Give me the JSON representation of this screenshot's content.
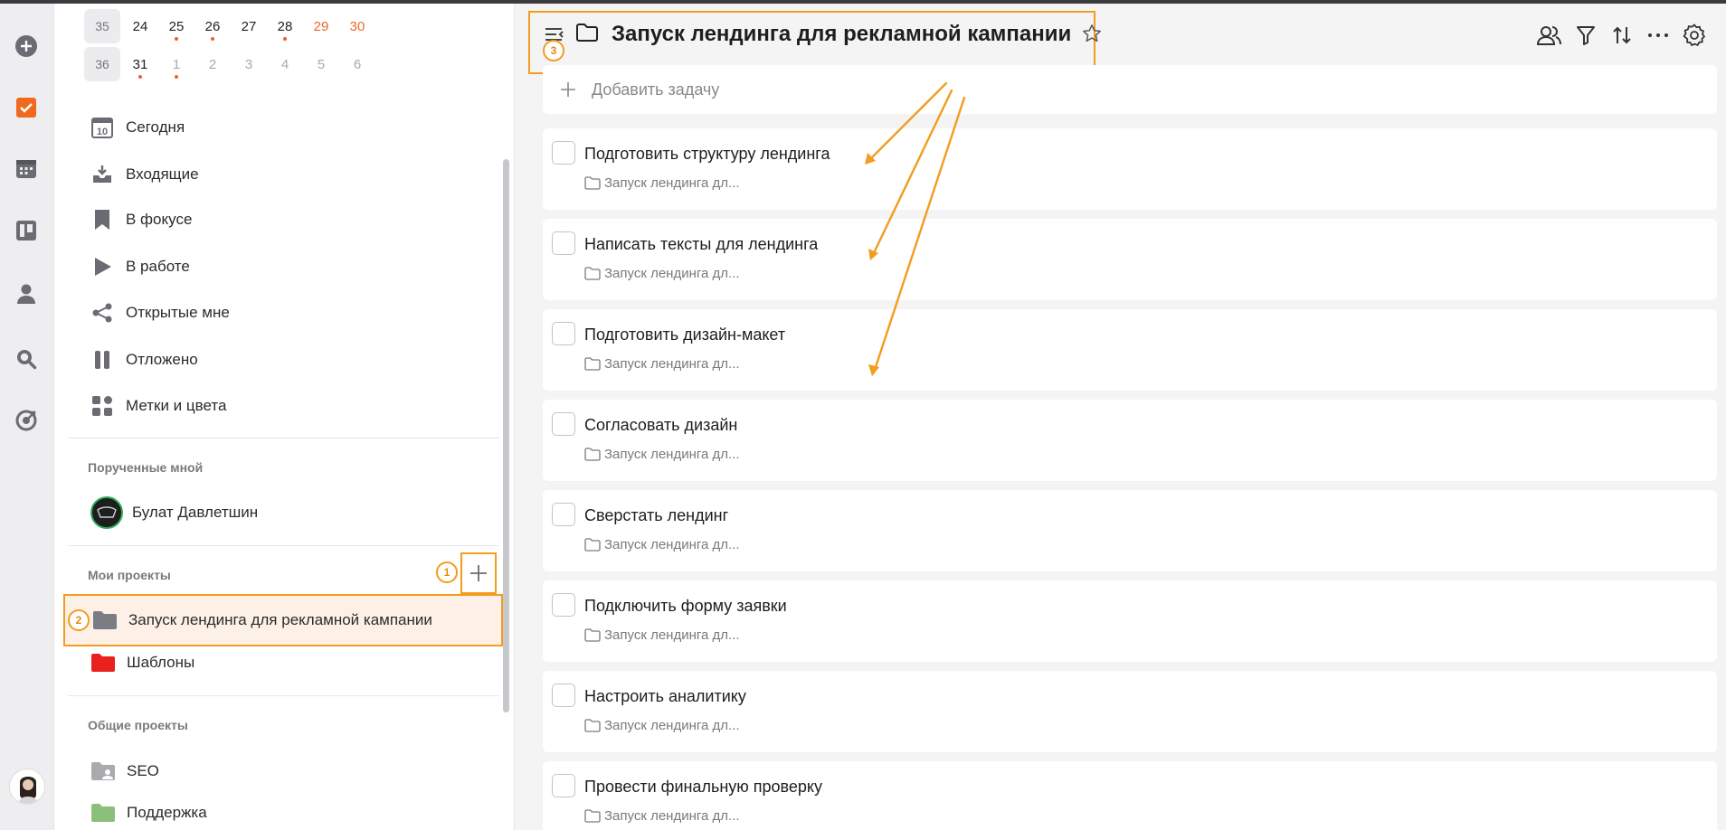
{
  "calendar": {
    "rows": [
      {
        "week": "35",
        "days": [
          {
            "d": "24",
            "cls": "",
            "dot": false
          },
          {
            "d": "25",
            "cls": "",
            "dot": true
          },
          {
            "d": "26",
            "cls": "",
            "dot": true
          },
          {
            "d": "27",
            "cls": "",
            "dot": false
          },
          {
            "d": "28",
            "cls": "",
            "dot": true
          },
          {
            "d": "29",
            "cls": "weekend",
            "dot": false
          },
          {
            "d": "30",
            "cls": "weekend",
            "dot": false
          }
        ]
      },
      {
        "week": "36",
        "days": [
          {
            "d": "31",
            "cls": "",
            "dot": true
          },
          {
            "d": "1",
            "cls": "dim",
            "dot": true
          },
          {
            "d": "2",
            "cls": "dim",
            "dot": false
          },
          {
            "d": "3",
            "cls": "dim",
            "dot": false
          },
          {
            "d": "4",
            "cls": "dim",
            "dot": false
          },
          {
            "d": "5",
            "cls": "dim",
            "dot": false
          },
          {
            "d": "6",
            "cls": "dim",
            "dot": false
          }
        ]
      }
    ]
  },
  "sidebar": {
    "nav": [
      {
        "label": "Сегодня",
        "icon": "calendar-today-icon",
        "badge": "10"
      },
      {
        "label": "Входящие",
        "icon": "inbox-icon"
      },
      {
        "label": "В фокусе",
        "icon": "bookmark-icon"
      },
      {
        "label": "В работе",
        "icon": "play-icon"
      },
      {
        "label": "Открытые мне",
        "icon": "share-icon"
      },
      {
        "label": "Отложено",
        "icon": "pause-icon"
      },
      {
        "label": "Метки и цвета",
        "icon": "tags-grid-icon"
      }
    ],
    "assigned_title": "Порученные мной",
    "assigned_user": "Булат Давлетшин",
    "my_projects_title": "Мои проекты",
    "my_projects": [
      {
        "label": "Запуск лендинга для рекламной кампании",
        "color": "#7c7c84"
      },
      {
        "label": "Шаблоны",
        "color": "#e8211f"
      }
    ],
    "shared_projects_title": "Общие проекты",
    "shared_projects": [
      {
        "label": "SEO",
        "color": "#9e9ea4"
      },
      {
        "label": "Поддержка",
        "color": "#8cc07a"
      }
    ],
    "badges": {
      "one": "1",
      "two": "2",
      "three": "3"
    }
  },
  "header": {
    "title": "Запуск лендинга для рекламной кампании"
  },
  "add_task": {
    "label": "Добавить задачу"
  },
  "tasks": [
    {
      "title": "Подготовить структуру лендинга",
      "project": "Запуск лендинга дл..."
    },
    {
      "title": "Написать тексты для лендинга",
      "project": "Запуск лендинга дл..."
    },
    {
      "title": "Подготовить дизайн-макет",
      "project": "Запуск лендинга дл..."
    },
    {
      "title": "Согласовать дизайн",
      "project": "Запуск лендинга дл..."
    },
    {
      "title": "Сверстать лендинг",
      "project": "Запуск лендинга дл..."
    },
    {
      "title": "Подключить форму заявки",
      "project": "Запуск лендинга дл..."
    },
    {
      "title": "Настроить аналитику",
      "project": "Запуск лендинга дл..."
    },
    {
      "title": "Провести финальную проверку",
      "project": "Запуск лендинга дл..."
    }
  ],
  "colors": {
    "accent": "#f39c1f",
    "brand": "#ef6a1f",
    "icon_gray": "#6b6b73"
  }
}
